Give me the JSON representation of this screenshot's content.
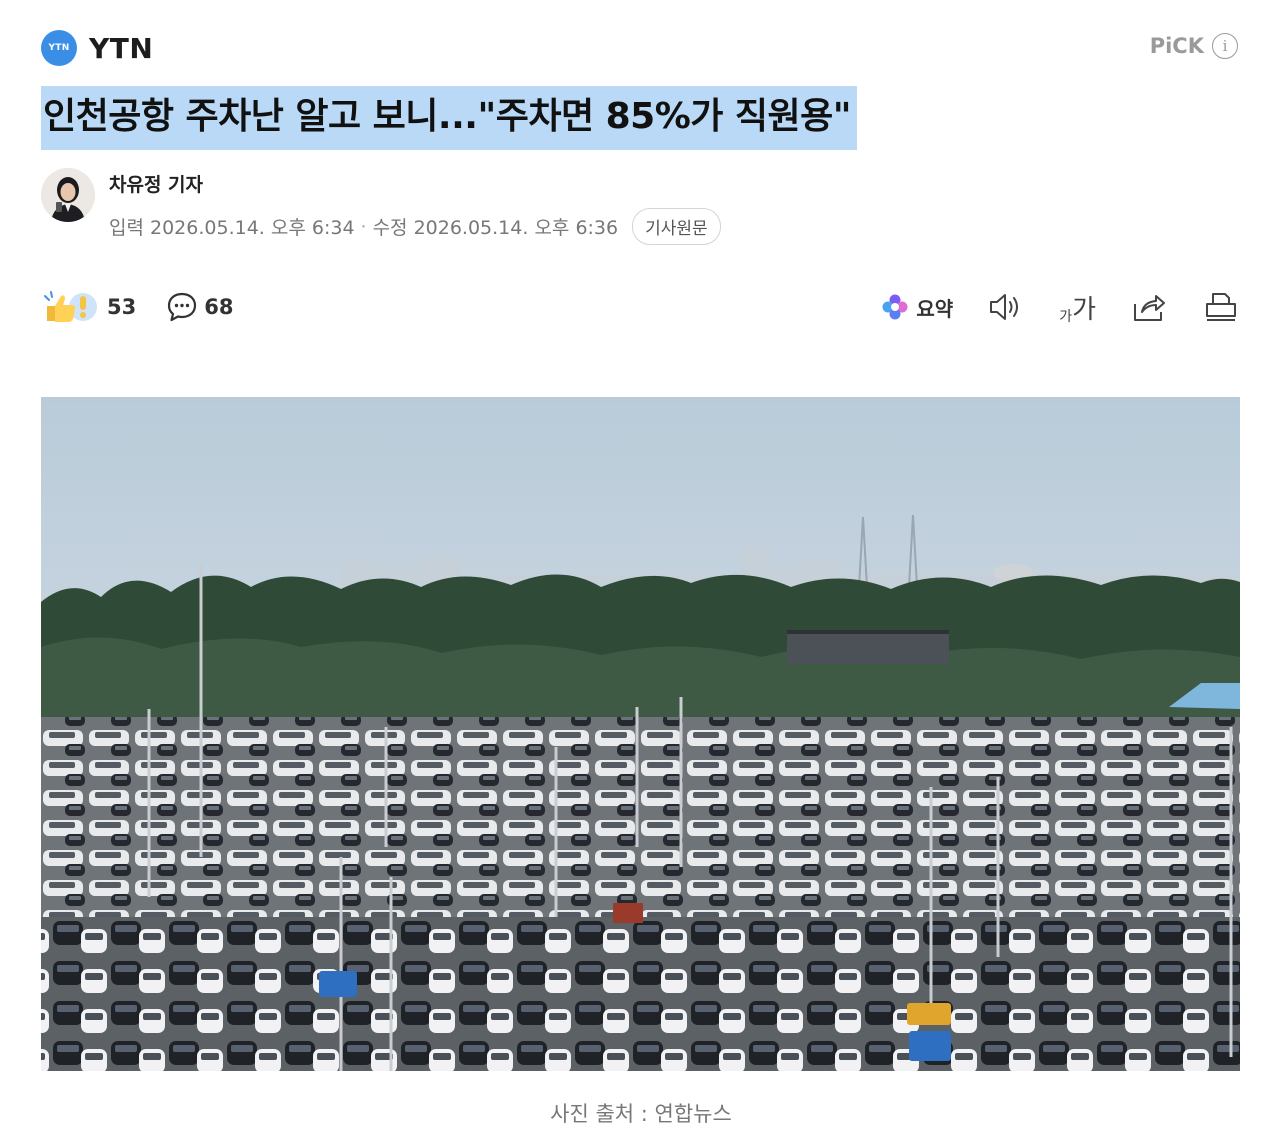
{
  "press": {
    "logo_text": "YTN",
    "name": "YTN"
  },
  "pick": {
    "label": "PiCK",
    "info_glyph": "i"
  },
  "headline": "인천공항 주차난 알고 보니...\"주차면 85%가 직원용\"",
  "byline": {
    "reporter": "차유정 기자",
    "published": "입력 2026.05.14. 오후 6:34",
    "separator": "·",
    "modified": "수정 2026.05.14. 오후 6:36",
    "original_button": "기사원문"
  },
  "actions": {
    "reaction_count": "53",
    "comment_count": "68",
    "summary_label": "요약",
    "font_small": "가",
    "font_big": "가"
  },
  "caption": "사진 출처 : 연합뉴스",
  "colors": {
    "highlight": "#b9d9f6",
    "logo_blue": "#3a8ee6"
  },
  "icons": [
    "thumbs-up-icon",
    "comment-icon",
    "summary-sparkle-icon",
    "speaker-icon",
    "font-size-icon",
    "share-icon",
    "print-icon",
    "info-icon"
  ]
}
